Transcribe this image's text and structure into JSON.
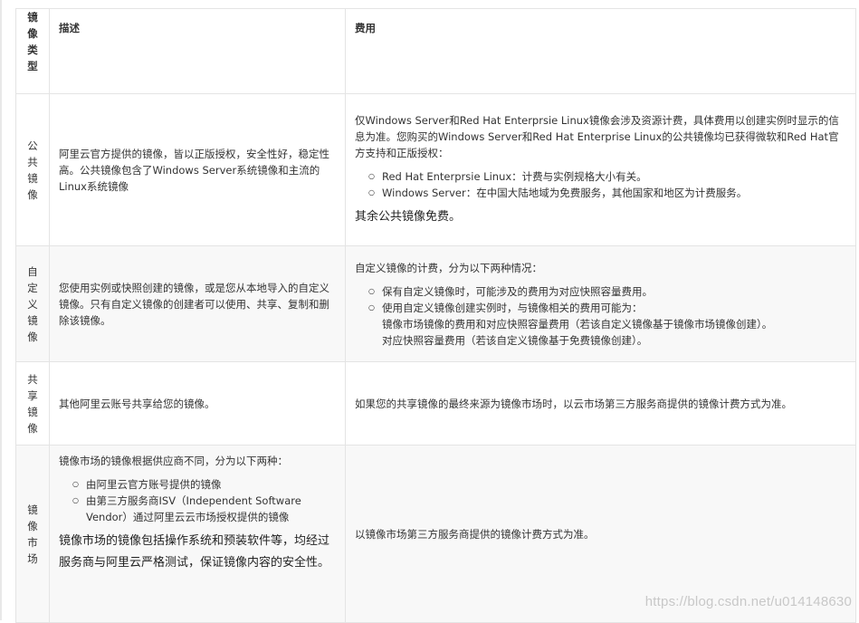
{
  "headers": [
    "镜像类型",
    "描述",
    "费用"
  ],
  "rows": [
    {
      "type": "公共镜像",
      "desc": "阿里云官方提供的镜像，皆以正版授权，安全性好，稳定性高。公共镜像包含了Windows Server系统镜像和主流的Linux系统镜像",
      "fee_intro": "仅Windows Server和Red Hat Enterprsie Linux镜像会涉及资源计费，具体费用以创建实例时显示的信息为准。您购买的Windows Server和Red Hat Enterprise Linux的公共镜像均已获得微软和Red Hat官方支持和正版授权：",
      "fee_items": [
        "Red Hat Enterprsie Linux：计费与实例规格大小有关。",
        "Windows Server：在中国大陆地域为免费服务，其他国家和地区为计费服务。"
      ],
      "fee_note": "其余公共镜像免费。"
    },
    {
      "type": "自定义镜像",
      "desc": "您使用实例或快照创建的镜像，或是您从本地导入的自定义镜像。只有自定义镜像的创建者可以使用、共享、复制和删除该镜像。",
      "fee_intro": "自定义镜像的计费，分为以下两种情况：",
      "fee_items": [
        "保有自定义镜像时，可能涉及的费用为对应快照容量费用。",
        "使用自定义镜像创建实例时，与镜像相关的费用可能为："
      ],
      "fee_subitems": [
        "镜像市场镜像的费用和对应快照容量费用（若该自定义镜像基于镜像市场镜像创建）。",
        "对应快照容量费用（若该自定义镜像基于免费镜像创建）。"
      ]
    },
    {
      "type": "共享镜像",
      "desc": "其他阿里云账号共享给您的镜像。",
      "fee": "如果您的共享镜像的最终来源为镜像市场时，以云市场第三方服务商提供的镜像计费方式为准。"
    },
    {
      "type": "镜像市场",
      "desc_intro": "镜像市场的镜像根据供应商不同，分为以下两种：",
      "desc_items": [
        "由阿里云官方账号提供的镜像",
        "由第三方服务商ISV（Independent Software Vendor）通过阿里云云市场授权提供的镜像"
      ],
      "desc_note": "镜像市场的镜像包括操作系统和预装软件等，均经过服务商与阿里云严格测试，保证镜像内容的安全性。",
      "fee": "以镜像市场第三方服务商提供的镜像计费方式为准。"
    }
  ],
  "watermark": "https://blog.csdn.net/u014148630"
}
